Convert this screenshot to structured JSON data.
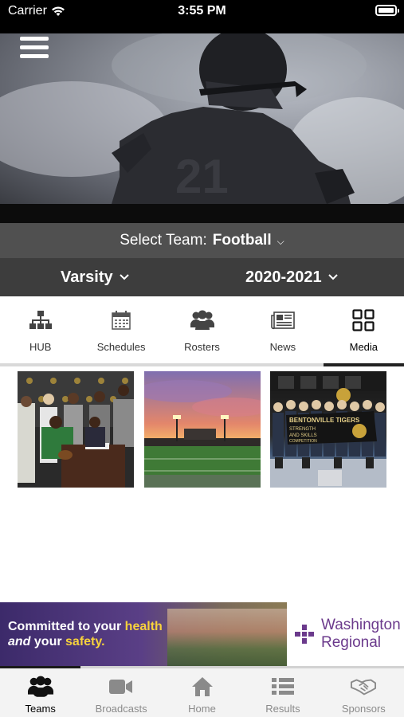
{
  "status_bar": {
    "carrier": "Carrier",
    "time": "3:55 PM"
  },
  "team_selector": {
    "prefix": "Select Team:",
    "value": "Football"
  },
  "level_selector": {
    "value": "Varsity"
  },
  "season_selector": {
    "value": "2020-2021"
  },
  "tabs": [
    {
      "label": "HUB",
      "icon": "hierarchy-icon"
    },
    {
      "label": "Schedules",
      "icon": "calendar-icon"
    },
    {
      "label": "Rosters",
      "icon": "people-icon"
    },
    {
      "label": "News",
      "icon": "newspaper-icon"
    },
    {
      "label": "Media",
      "icon": "grid-icon",
      "active": true
    }
  ],
  "media": {
    "thumbnails": [
      {
        "overlay_text": ""
      },
      {
        "overlay_text": ""
      },
      {
        "overlay_text": "BENTONVILLE TIGERS STRENGTH AND SKILLS COMPETITION"
      }
    ]
  },
  "banner": {
    "line1_a": "Committed to your ",
    "line1_b": "health",
    "line2_a": "and",
    "line2_b": " your ",
    "line2_c": "safety.",
    "brand_line1": "Washington",
    "brand_line2": "Regional",
    "brand_color": "#6b3a8c"
  },
  "bottom_nav": [
    {
      "label": "Teams",
      "icon": "people-icon",
      "active": true
    },
    {
      "label": "Broadcasts",
      "icon": "video-camera-icon"
    },
    {
      "label": "Home",
      "icon": "home-icon"
    },
    {
      "label": "Results",
      "icon": "list-icon"
    },
    {
      "label": "Sponsors",
      "icon": "handshake-icon"
    }
  ]
}
